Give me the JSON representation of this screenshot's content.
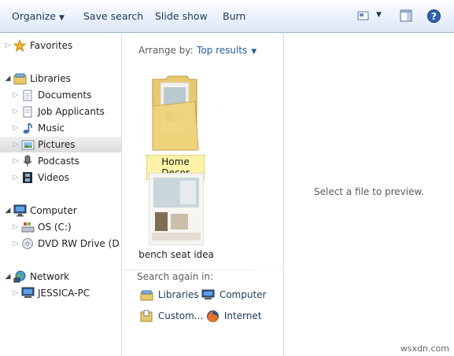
{
  "toolbar": {
    "organize": "Organize",
    "save_search": "Save search",
    "slide_show": "Slide show",
    "burn": "Burn"
  },
  "nav": {
    "favorites": "Favorites",
    "libraries": "Libraries",
    "library_items": [
      "Documents",
      "Job Applicants",
      "Music",
      "Pictures",
      "Podcasts",
      "Videos"
    ],
    "computer": "Computer",
    "computer_items": [
      "OS (C:)",
      "DVD RW Drive (D:) A"
    ],
    "network": "Network",
    "network_items": [
      "JESSICA-PC"
    ]
  },
  "main": {
    "arrange_label": "Arrange by:",
    "arrange_value": "Top results",
    "items": [
      {
        "name": "Home Decor",
        "type": "folder",
        "selected": true
      },
      {
        "name": "bench seat idea",
        "type": "image"
      }
    ],
    "search_again_label": "Search again in:",
    "search_locations": [
      "Libraries",
      "Computer",
      "Custom...",
      "Internet"
    ]
  },
  "preview": {
    "message": "Select a file to preview."
  },
  "watermark": "wsxdn.com",
  "colors": {
    "link": "#1f5fa9",
    "toolbar_text": "#1e395b",
    "selection_highlight": "#fdf3a7"
  }
}
